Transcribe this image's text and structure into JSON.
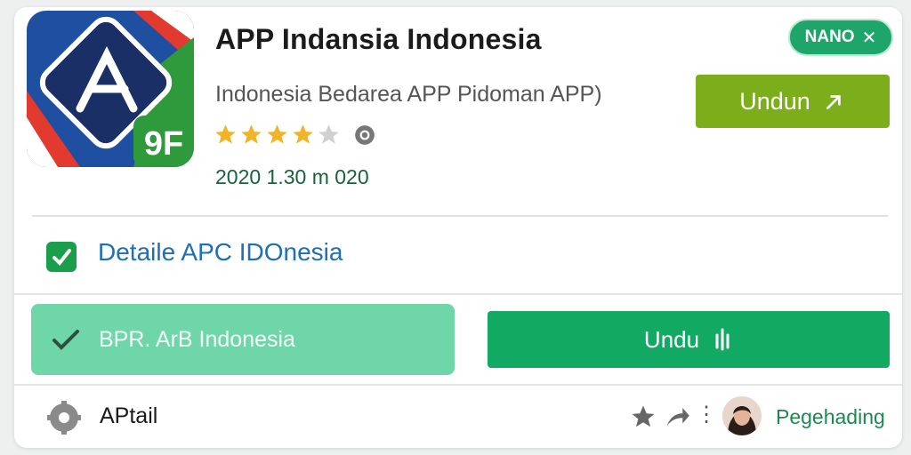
{
  "header": {
    "title": "APP Indansia Indonesia",
    "subtitle": "Indonesia Bedarea APP Pidoman APP)",
    "rating_stars": 4,
    "meta": "2020 1.30 m 020",
    "badge_label": "NANO",
    "badge_close": "✕",
    "install_label": "Undun",
    "icon_label": "9F"
  },
  "detail": {
    "label": "Detaile APC IDOnesia"
  },
  "actions": {
    "left_label": "BPR. ArB Indonesia",
    "right_label": "Undu"
  },
  "footer": {
    "label": "APtail",
    "user_label": "Pegehading"
  },
  "colors": {
    "accent_green": "#12a963",
    "light_green": "#6fd6aa",
    "lime": "#7cad1b",
    "link_blue": "#1e6fb5",
    "star": "#f0b428"
  },
  "icons": [
    "app-logo-icon",
    "star-icon",
    "globe-icon",
    "close-icon",
    "arrow-icon",
    "check-icon",
    "download-icon",
    "settings-icon",
    "share-icon",
    "more-icon"
  ]
}
